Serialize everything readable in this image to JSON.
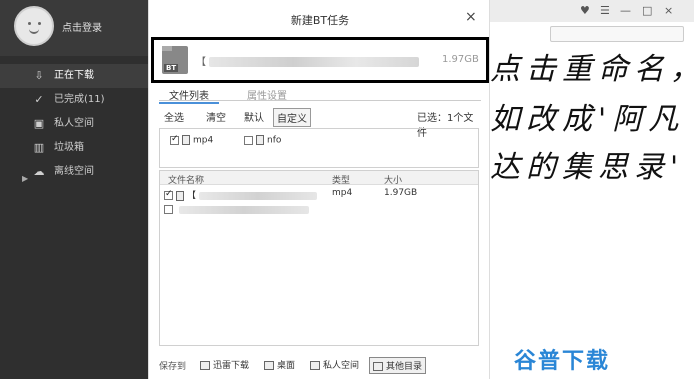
{
  "sidebar": {
    "login_label": "点击登录",
    "items": [
      {
        "label": "正在下载",
        "icon": "download-icon"
      },
      {
        "label": "已完成(11)",
        "icon": "check-circle-icon"
      },
      {
        "label": "私人空间",
        "icon": "lock-icon"
      },
      {
        "label": "垃圾箱",
        "icon": "trash-icon"
      },
      {
        "label": "离线空间",
        "icon": "cloud-icon"
      }
    ]
  },
  "dialog": {
    "title": "新建BT任务",
    "close": "×",
    "file": {
      "badge": "BT",
      "name_prefix": "【",
      "size": "1.97GB"
    },
    "tabs": [
      "文件列表",
      "属性设置"
    ],
    "toolbar": {
      "all": "全选",
      "clear": "清空",
      "default": "默认",
      "custom": "自定义",
      "selected": "已选：1个文件"
    },
    "types": [
      {
        "label": "mp4",
        "checked": true
      },
      {
        "label": "nfo",
        "checked": false
      }
    ],
    "list": {
      "headers": {
        "name": "文件名称",
        "type": "类型",
        "size": "大小"
      },
      "rows": [
        {
          "prefix": "【",
          "type": "mp4",
          "size": "1.97GB",
          "checked": true
        },
        {
          "prefix": "",
          "type": "",
          "size": "",
          "checked": false
        }
      ]
    },
    "save": {
      "label": "保存到",
      "options": [
        "迅雷下载",
        "桌面",
        "私人空间",
        "其他目录"
      ],
      "selected": "其他目录"
    }
  },
  "right": {
    "controls": [
      "♥",
      "☰",
      "—",
      "□",
      "×"
    ],
    "note_lines": [
      "点击重命名，",
      "如改成'阿凡",
      "达的集思录'"
    ],
    "watermark": "谷普下载"
  }
}
